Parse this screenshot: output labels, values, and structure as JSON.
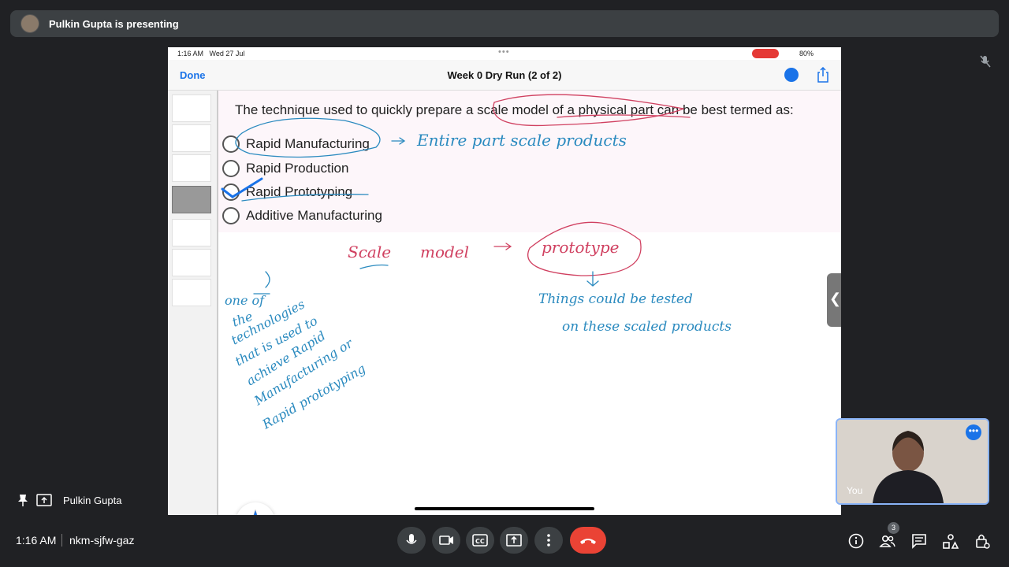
{
  "topbar": {
    "presenting_text": "Pulkin Gupta is presenting"
  },
  "ipad": {
    "status_time": "1:16 AM",
    "status_date": "Wed 27 Jul",
    "status_dots": "•••",
    "battery": "80%",
    "done_label": "Done",
    "doc_title": "Week 0 Dry Run (2 of 2)"
  },
  "slide": {
    "question": "The technique used to quickly prepare a scale model of a physical part can be best termed as:",
    "options": [
      "Rapid Manufacturing",
      "Rapid Production",
      "Rapid Prototyping",
      "Additive Manufacturing"
    ],
    "selected_option": "Rapid Prototyping"
  },
  "handwriting": {
    "note1": "Entire part scale products",
    "note2": "Scale model",
    "note3": "prototype",
    "note4": "one of the technologies that is used to achieve Rapid Manufacturing or Rapid prototyping",
    "note5": "Things could be tested on these scaled products"
  },
  "presenter_tile": {
    "name": "Pulkin Gupta"
  },
  "self_view": {
    "label": "You"
  },
  "bottom_bar": {
    "time": "1:16 AM",
    "meeting_code": "nkm-sjfw-gaz",
    "participants_count": "3",
    "end_call_color": "#ea4335"
  },
  "icons": [
    "mic-off-icon",
    "mic-icon",
    "camera-icon",
    "captions-icon",
    "present-icon",
    "more-icon",
    "end-call-icon",
    "info-icon",
    "people-icon",
    "chat-icon",
    "activities-icon",
    "host-controls-icon",
    "pin-icon",
    "pencil-icon",
    "share-icon"
  ]
}
